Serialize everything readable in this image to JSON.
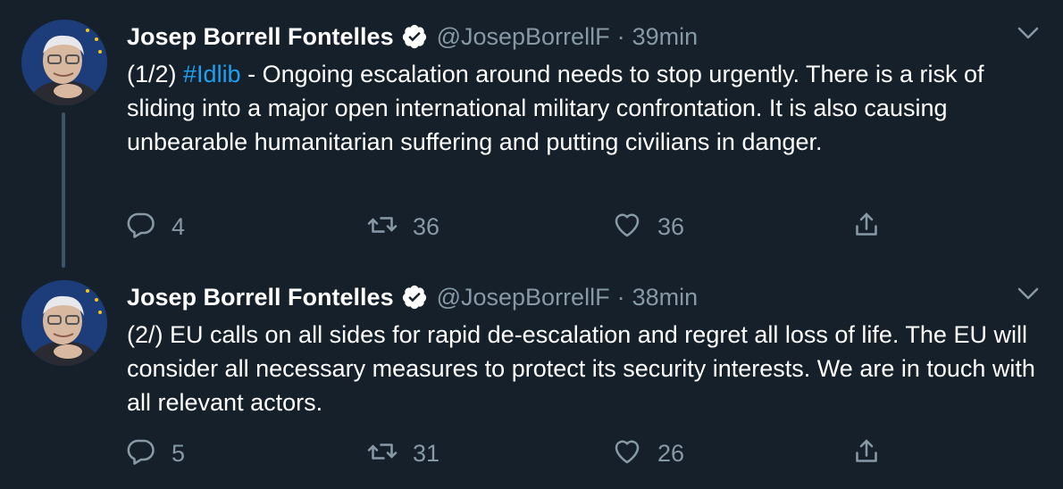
{
  "tweets": [
    {
      "author_name": "Josep Borrell Fontelles",
      "handle": "@JosepBorrellF",
      "separator": "·",
      "time": "39min",
      "text_prefix": "(1/2) ",
      "hashtag": "#Idlib",
      "text_suffix": " - Ongoing escalation around needs to stop urgently. There is a risk of sliding into a major open international military confrontation. It is also causing unbearable humanitarian suffering and putting civilians in danger.",
      "replies": "4",
      "retweets": "36",
      "likes": "36"
    },
    {
      "author_name": "Josep Borrell Fontelles",
      "handle": "@JosepBorrellF",
      "separator": "·",
      "time": "38min",
      "text": "(2/) EU calls on all sides for rapid de-escalation and regret all loss of life. The EU will consider all necessary measures to protect its security interests. We are in touch with all relevant actors.",
      "replies": "5",
      "retweets": "31",
      "likes": "26"
    }
  ],
  "icons": {
    "verified": "verified-badge-icon",
    "caret": "chevron-down-icon",
    "reply": "reply-icon",
    "retweet": "retweet-icon",
    "like": "heart-icon",
    "share": "share-icon"
  },
  "colors": {
    "background": "#15202b",
    "text": "#ffffff",
    "secondary": "#8899a6",
    "link": "#1da1f2",
    "thread_line": "#3d5466"
  }
}
